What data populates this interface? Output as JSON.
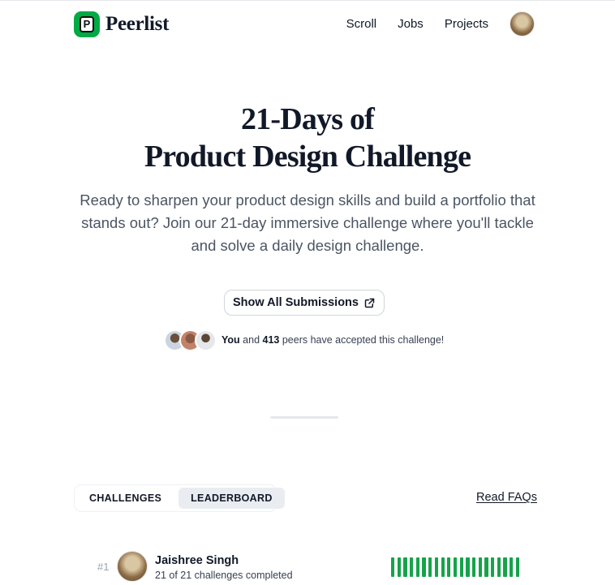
{
  "brand": {
    "name": "Peerlist",
    "logo_letter": "P",
    "accent_color": "#00aa45"
  },
  "nav": {
    "items": [
      {
        "label": "Scroll"
      },
      {
        "label": "Jobs"
      },
      {
        "label": "Projects"
      }
    ]
  },
  "hero": {
    "title_line1": "21-Days of",
    "title_line2": "Product Design Challenge",
    "description": "Ready to sharpen your product design skills and build a portfolio that stands out? Join our 21-day immersive challenge where you'll tackle and solve a daily design challenge."
  },
  "submissions_button": {
    "label": "Show All Submissions",
    "icon": "external-link-icon"
  },
  "peers": {
    "you_label": "You",
    "and_text": " and ",
    "count": "413",
    "suffix_text": " peers have accepted this challenge!"
  },
  "tabs": [
    {
      "label": "CHALLENGES",
      "active": false
    },
    {
      "label": "LEADERBOARD",
      "active": true
    }
  ],
  "faqs_link": "Read FAQs",
  "leaderboard": [
    {
      "rank": "#1",
      "name": "Jaishree Singh",
      "progress_text": "21 of 21 challenges completed",
      "completed": 21,
      "total": 21,
      "bar_color": "#16a34a"
    }
  ]
}
